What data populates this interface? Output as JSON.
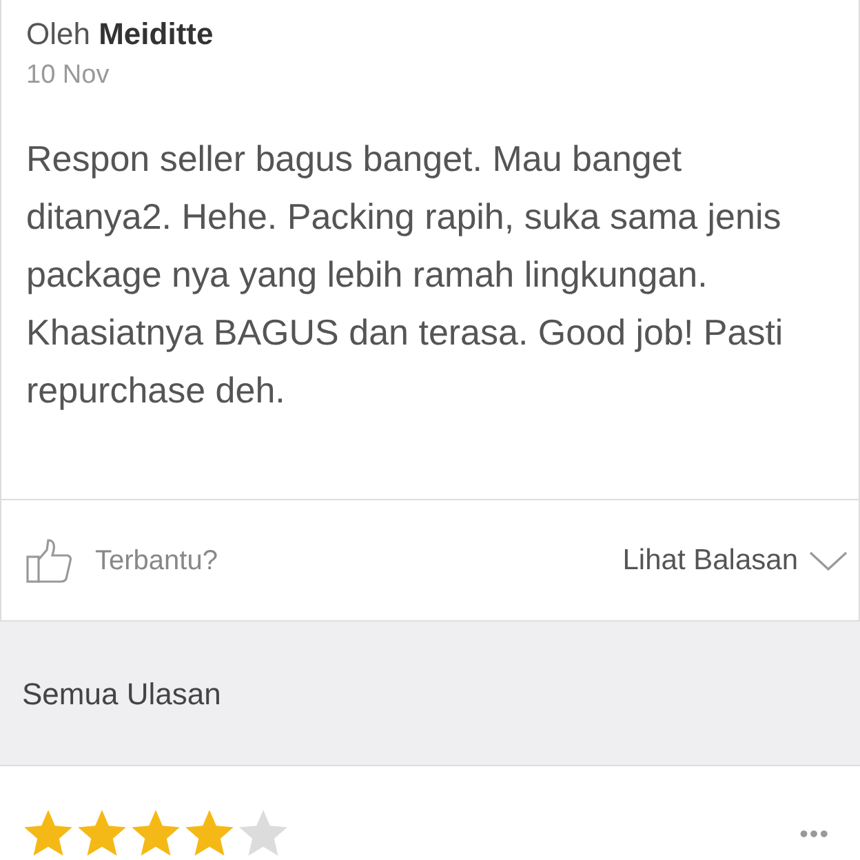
{
  "review": {
    "author": "Oleh **Meiditte**",
    "date": "10 Nov",
    "text": "Respon seller bagus banget. Mau banget ditanya2. Hehe. Packing rapih, suka sama jenis package nya yang lebih ramah lingkungan. Khasiatnya BAGUS dan terasa. Good job! Pasti repurchase deh.",
    "helpful_label": "Terbantu?",
    "replies_label": "Lihat Balasan"
  },
  "section_title": "Semua Ulasan",
  "next_review": {
    "stars": 4,
    "more": "•••"
  }
}
